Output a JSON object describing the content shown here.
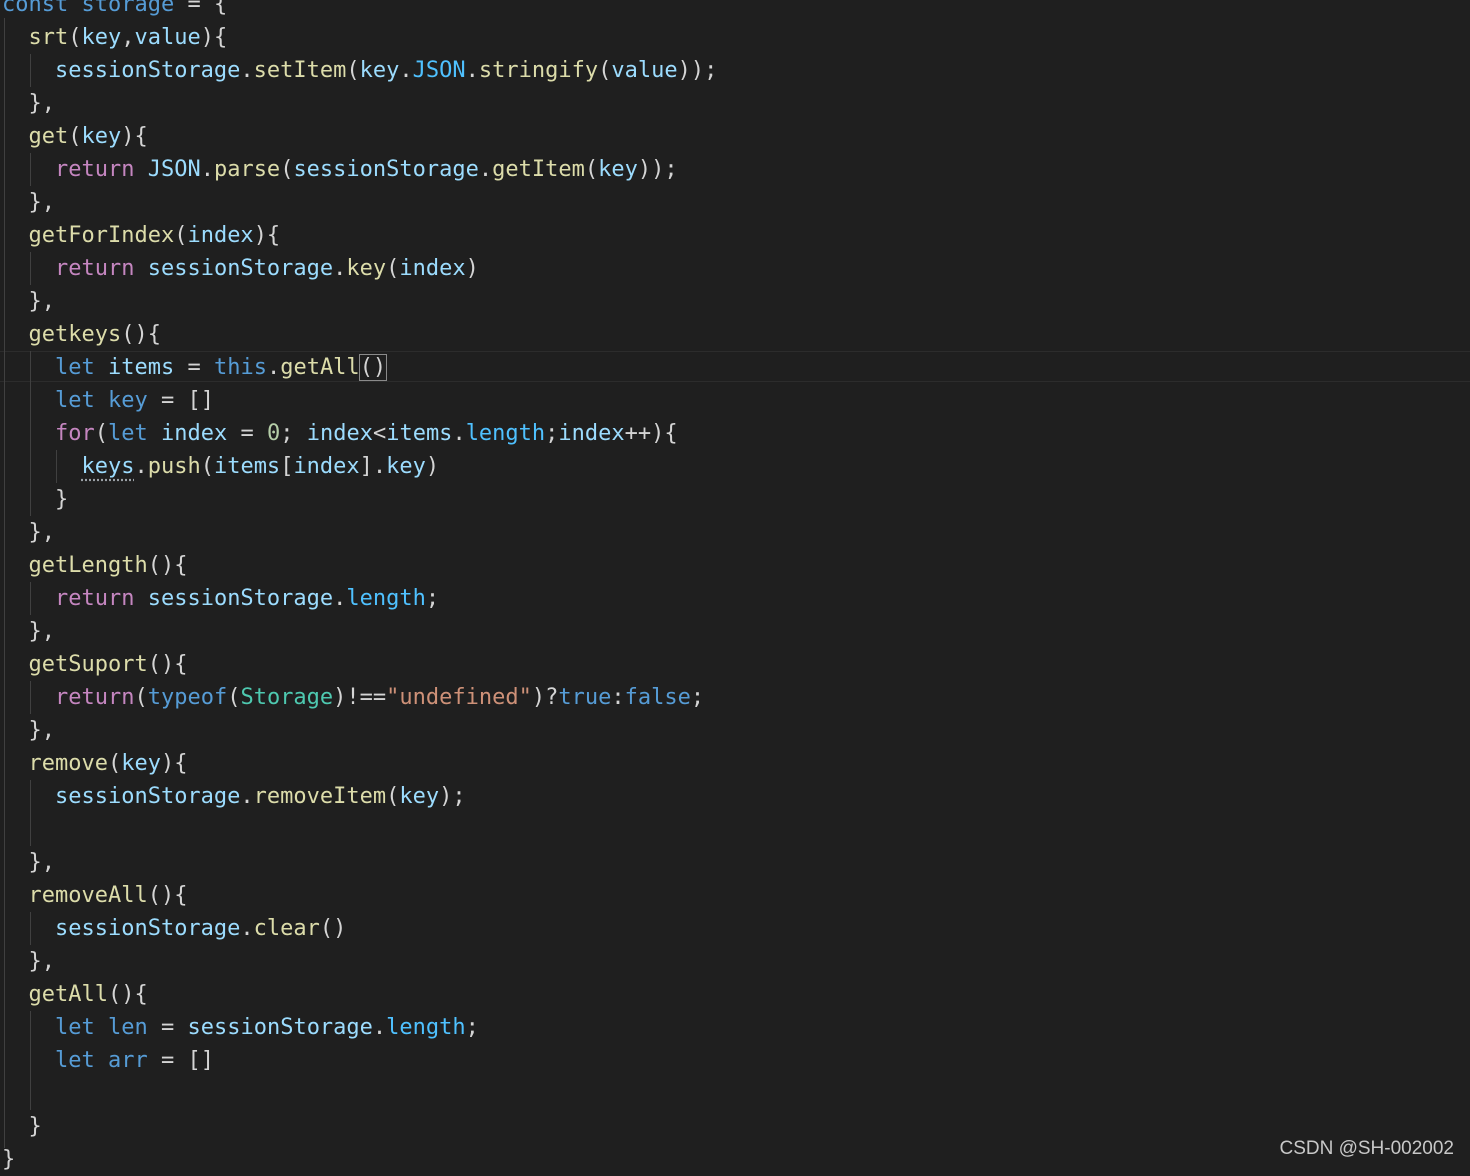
{
  "editor": {
    "lines": [
      "const storage = {",
      "  srt(key,value){",
      "    sessionStorage.setItem(key.JSON.stringify(value));",
      "  },",
      "  get(key){",
      "    return JSON.parse(sessionStorage.getItem(key));",
      "  },",
      "  getForIndex(index){",
      "    return sessionStorage.key(index)",
      "  },",
      "  getkeys(){",
      "    let items = this.getAll()",
      "    let key = []",
      "    for(let index = 0; index<items.length;index++){",
      "      keys.push(items[index].key)",
      "    }",
      "  },",
      "  getLength(){",
      "    return sessionStorage.length;",
      "  },",
      "  getSuport(){",
      "    return(typeof(Storage)!==\"undefined\")?true:false;",
      "  },",
      "  remove(key){",
      "    sessionStorage.removeItem(key);",
      "",
      "  },",
      "  removeAll(){",
      "    sessionStorage.clear()",
      "  },",
      "  getAll(){",
      "    let len = sessionStorage.length;",
      "    let arr = []",
      "",
      "  }",
      "}"
    ]
  },
  "watermark": "CSDN @SH-002002",
  "colors": {
    "background": "#1f1f1f",
    "keyword": "#569cd6",
    "control": "#c586c0",
    "function": "#dcdcaa",
    "variable": "#9cdcfe",
    "property": "#4fc1ff",
    "string": "#ce9178",
    "type": "#4ec9b0",
    "number": "#b5cea8"
  }
}
